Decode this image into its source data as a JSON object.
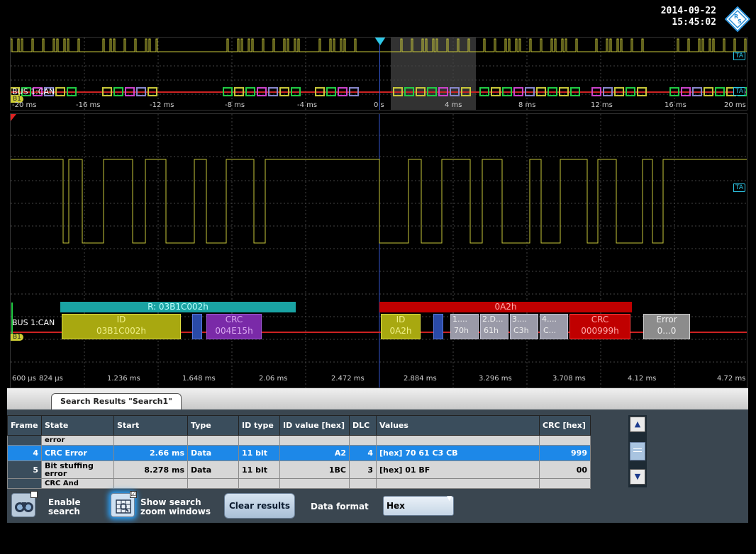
{
  "header": {
    "date": "2014-09-22",
    "time": "15:45:02",
    "logo_icon": "rohde-schwarz-logo-icon"
  },
  "overview": {
    "bus_label": "BUS 1:CAN",
    "tag_label": "TA",
    "b1_label": "B1",
    "time_ticks": [
      "-20 ms",
      "-16 ms",
      "-12 ms",
      "-8 ms",
      "-4 ms",
      "0 s",
      "4 ms",
      "8 ms",
      "12 ms",
      "16 ms",
      "20 ms"
    ]
  },
  "mainwave": {
    "bus_label": "BUS 1:CAN",
    "tag_label": "TA",
    "b1_label": "B1",
    "time_ticks": [
      "600 µs",
      "824 µs",
      "1.236 ms",
      "1.648 ms",
      "2.06 ms",
      "2.472 ms",
      "2.884 ms",
      "3.296 ms",
      "3.708 ms",
      "4.12 ms",
      "4.72 ms"
    ],
    "frame1": {
      "header": "R: 03B1C002h",
      "id_label": "ID",
      "id_value": "03B1C002h",
      "crc_label": "CRC",
      "crc_value": "004E15h"
    },
    "frame2": {
      "header": "0A2h",
      "id_label": "ID",
      "id_value": "0A2h",
      "d1_label": "1....",
      "d1_value": "70h",
      "d2_label": "2.D...",
      "d2_value": "61h",
      "d3_label": "3....",
      "d3_value": "C3h",
      "d4_label": "4....",
      "d4_value": "C...",
      "crc_label": "CRC",
      "crc_value": "000999h",
      "error_label": "Error",
      "error_value": "0...0"
    }
  },
  "results": {
    "tab_label": "Search Results \"Search1\"",
    "columns": [
      "Frame",
      "State",
      "Start",
      "Type",
      "ID type",
      "ID value [hex]",
      "DLC",
      "Values",
      "CRC [hex]"
    ],
    "partial_top": {
      "state": "error"
    },
    "rows": [
      {
        "frame": "4",
        "state": "CRC Error",
        "start": "2.66 ms",
        "type": "Data",
        "id_type": "11 bit",
        "id_value": "A2",
        "dlc": "4",
        "values": "[hex] 70 61 C3 CB",
        "crc": "999"
      },
      {
        "frame": "5",
        "state": "Bit stuffing error",
        "start": "8.278 ms",
        "type": "Data",
        "id_type": "11 bit",
        "id_value": "1BC",
        "dlc": "3",
        "values": "[hex] 01 BF",
        "crc": "00"
      }
    ],
    "partial_bottom": {
      "state": "CRC And"
    }
  },
  "toolbar": {
    "enable_search_line1": "Enable",
    "enable_search_line2": "search",
    "show_zoom_line1": "Show search",
    "show_zoom_line2": "zoom windows",
    "show_zoom_checked": "☑",
    "clear_results": "Clear results",
    "data_format_label": "Data format",
    "data_format_value": "Hex"
  },
  "colors": {
    "signal": "#c8c83a",
    "frame_header": "#1aa3a3",
    "error_frame": "#d00000",
    "selected_row": "#1d88e8"
  }
}
